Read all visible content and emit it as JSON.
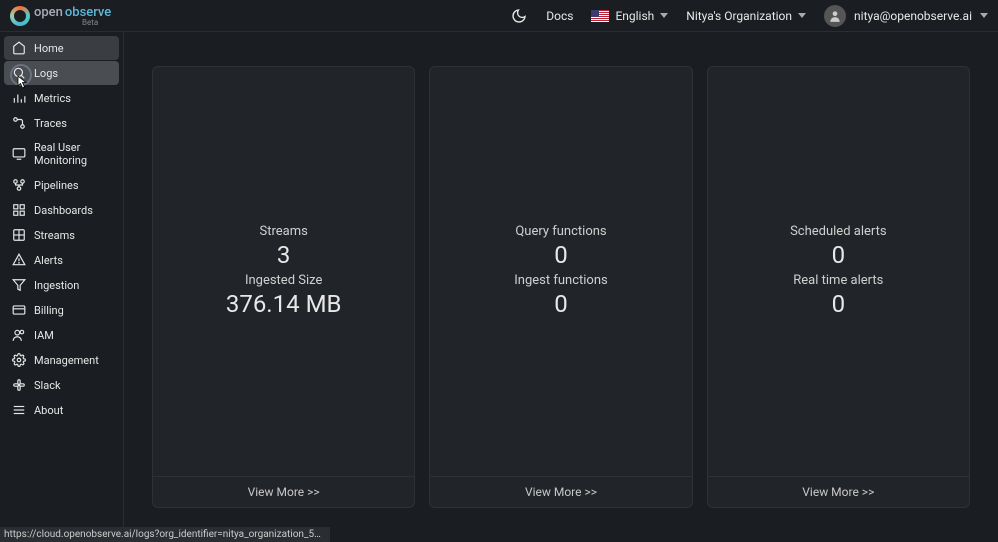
{
  "header": {
    "logo_open": "open",
    "logo_observe": "observe",
    "logo_beta": "Beta",
    "docs": "Docs",
    "language": "English",
    "org": "Nitya's Organization",
    "user_email": "nitya@openobserve.ai"
  },
  "sidebar": {
    "items": [
      {
        "label": "Home"
      },
      {
        "label": "Logs"
      },
      {
        "label": "Metrics"
      },
      {
        "label": "Traces"
      },
      {
        "label": "Real User Monitoring"
      },
      {
        "label": "Pipelines"
      },
      {
        "label": "Dashboards"
      },
      {
        "label": "Streams"
      },
      {
        "label": "Alerts"
      },
      {
        "label": "Ingestion"
      },
      {
        "label": "Billing"
      },
      {
        "label": "IAM"
      },
      {
        "label": "Management"
      },
      {
        "label": "Slack"
      },
      {
        "label": "About"
      }
    ]
  },
  "cards": {
    "streams": {
      "label1": "Streams",
      "value1": "3",
      "label2": "Ingested Size",
      "value2": "376.14 MB",
      "link": "View More >>"
    },
    "functions": {
      "label1": "Query functions",
      "value1": "0",
      "label2": "Ingest functions",
      "value2": "0",
      "link": "View More >>"
    },
    "alerts": {
      "label1": "Scheduled alerts",
      "value1": "0",
      "label2": "Real time alerts",
      "value2": "0",
      "link": "View More >>"
    }
  },
  "status_url": "https://cloud.openobserve.ai/logs?org_identifier=nitya_organization_50763_nJO9en..."
}
